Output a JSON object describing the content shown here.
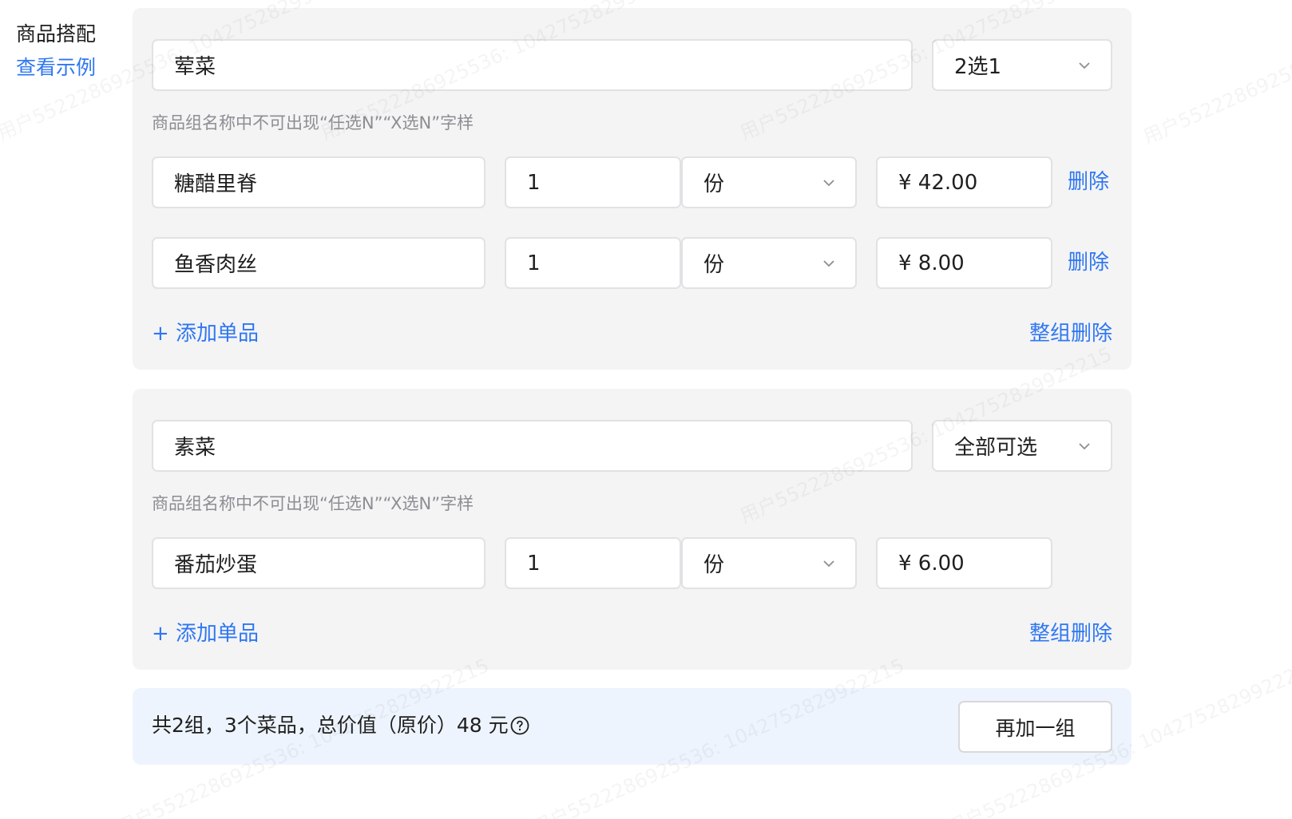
{
  "side": {
    "title": "商品搭配",
    "example_link": "查看示例"
  },
  "groups": [
    {
      "name": "荤菜",
      "rule": "2选1",
      "hint": "商品组名称中不可出现“任选N”“X选N”字样",
      "items": [
        {
          "name": "糖醋里脊",
          "qty": "1",
          "unit": "份",
          "price": "¥ 42.00",
          "delete": "删除"
        },
        {
          "name": "鱼香肉丝",
          "qty": "1",
          "unit": "份",
          "price": "¥ 8.00",
          "delete": "删除"
        }
      ],
      "add_item": "+ 添加单品",
      "delete_group": "整组删除"
    },
    {
      "name": "素菜",
      "rule": "全部可选",
      "hint": "商品组名称中不可出现“任选N”“X选N”字样",
      "items": [
        {
          "name": "番茄炒蛋",
          "qty": "1",
          "unit": "份",
          "price": "¥ 6.00"
        }
      ],
      "add_item": "+ 添加单品",
      "delete_group": "整组删除"
    }
  ],
  "summary": {
    "text": "共2组，3个菜品，总价值（原价）48 元",
    "add_group": "再加一组"
  },
  "watermark": "用户5522286925536: 1042752829922215",
  "colors": {
    "link": "#2f77f1",
    "card_bg": "#f4f4f5",
    "summary_bg": "#eef4fd",
    "hint": "#8d8d93"
  }
}
